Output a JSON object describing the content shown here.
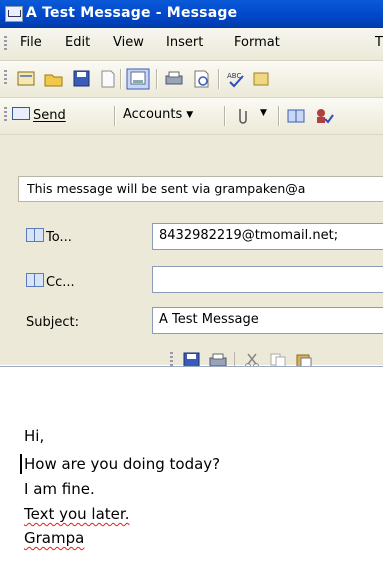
{
  "window": {
    "title": "A Test Message - Message"
  },
  "menu": {
    "items": [
      "File",
      "Edit",
      "View",
      "Insert",
      "Format",
      "T"
    ]
  },
  "toolbar2": {
    "send_label": "Send",
    "accounts_label": "Accounts"
  },
  "info": {
    "text": "This message will be sent via grampaken@a"
  },
  "fields": {
    "to_label": "To...",
    "to_value": "8432982219@tmomail.net;",
    "cc_label": "Cc...",
    "cc_value": "",
    "subject_label": "Subject:",
    "subject_value": "A Test Message"
  },
  "body": {
    "lines": [
      "Hi,",
      "How are you doing today?",
      "I am fine.",
      "Text you later.",
      "Grampa"
    ]
  },
  "icons": [
    "new-icon",
    "open-icon",
    "save-icon",
    "print-preview-icon",
    "print-icon",
    "spell-icon",
    "attach-icon",
    "address-book-icon",
    "check-names-icon"
  ],
  "colors": {
    "titlebar": "#0046c8",
    "accent": "#ece9d8"
  }
}
